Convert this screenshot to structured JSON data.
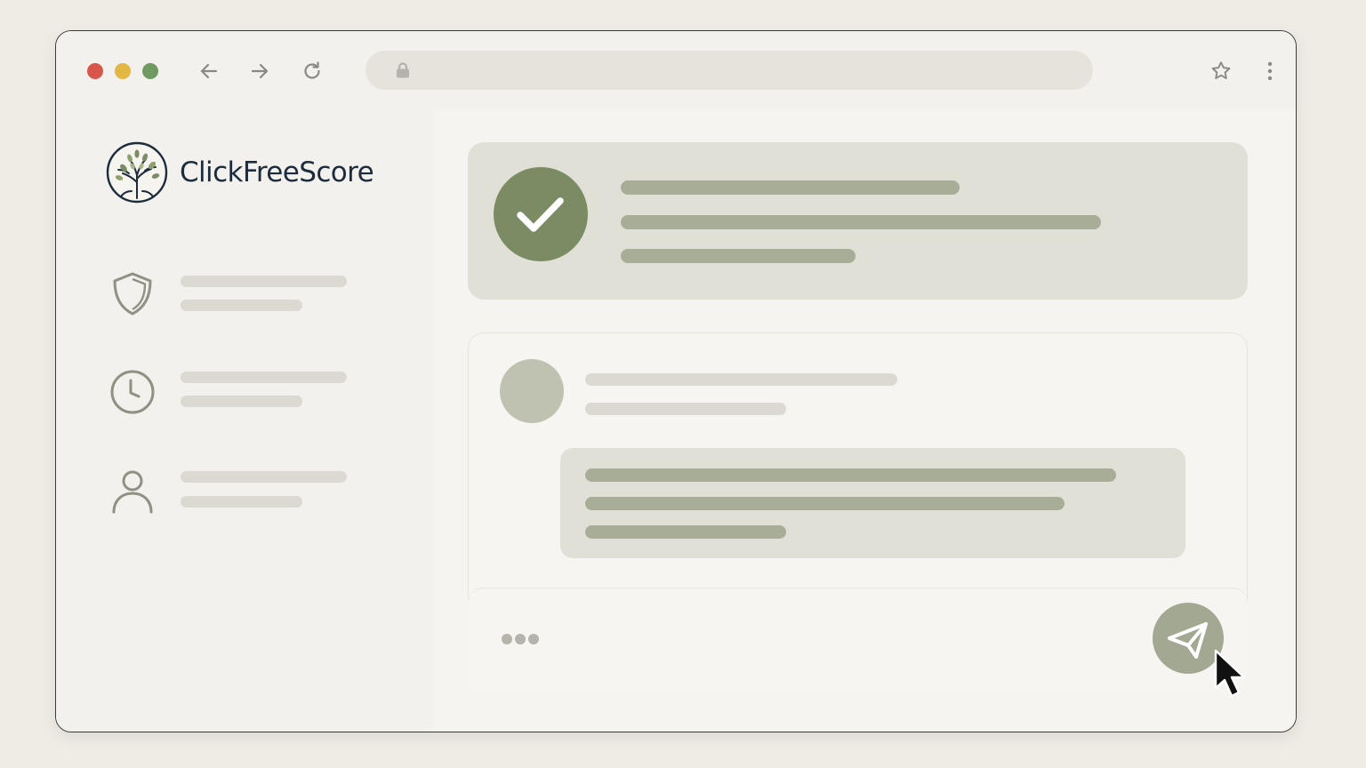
{
  "browser": {
    "url": "",
    "traffic_light_colors": {
      "close": "#d7574b",
      "minimize": "#e3b744",
      "maximize": "#6f9a62"
    },
    "icons": [
      "back-arrow-icon",
      "forward-arrow-icon",
      "reload-icon",
      "lock-icon",
      "star-icon",
      "kebab-menu-icon"
    ]
  },
  "sidebar": {
    "brand_name": "ClickFreeScore",
    "logo_icon": "tree-logo-icon",
    "items": [
      {
        "icon": "shield-icon"
      },
      {
        "icon": "clock-icon"
      },
      {
        "icon": "user-icon"
      }
    ]
  },
  "main": {
    "success_card": {
      "icon": "checkmark-icon"
    },
    "chat_card": {
      "composer": {
        "typing_indicator_icon": "ellipsis-icon",
        "send_icon": "send-plane-icon"
      }
    }
  },
  "colors": {
    "accent_dark": "#7b8b63",
    "accent_muted": "#a3a892",
    "card_fill": "#e1e0d6",
    "brand_text": "#1d2c3c"
  }
}
